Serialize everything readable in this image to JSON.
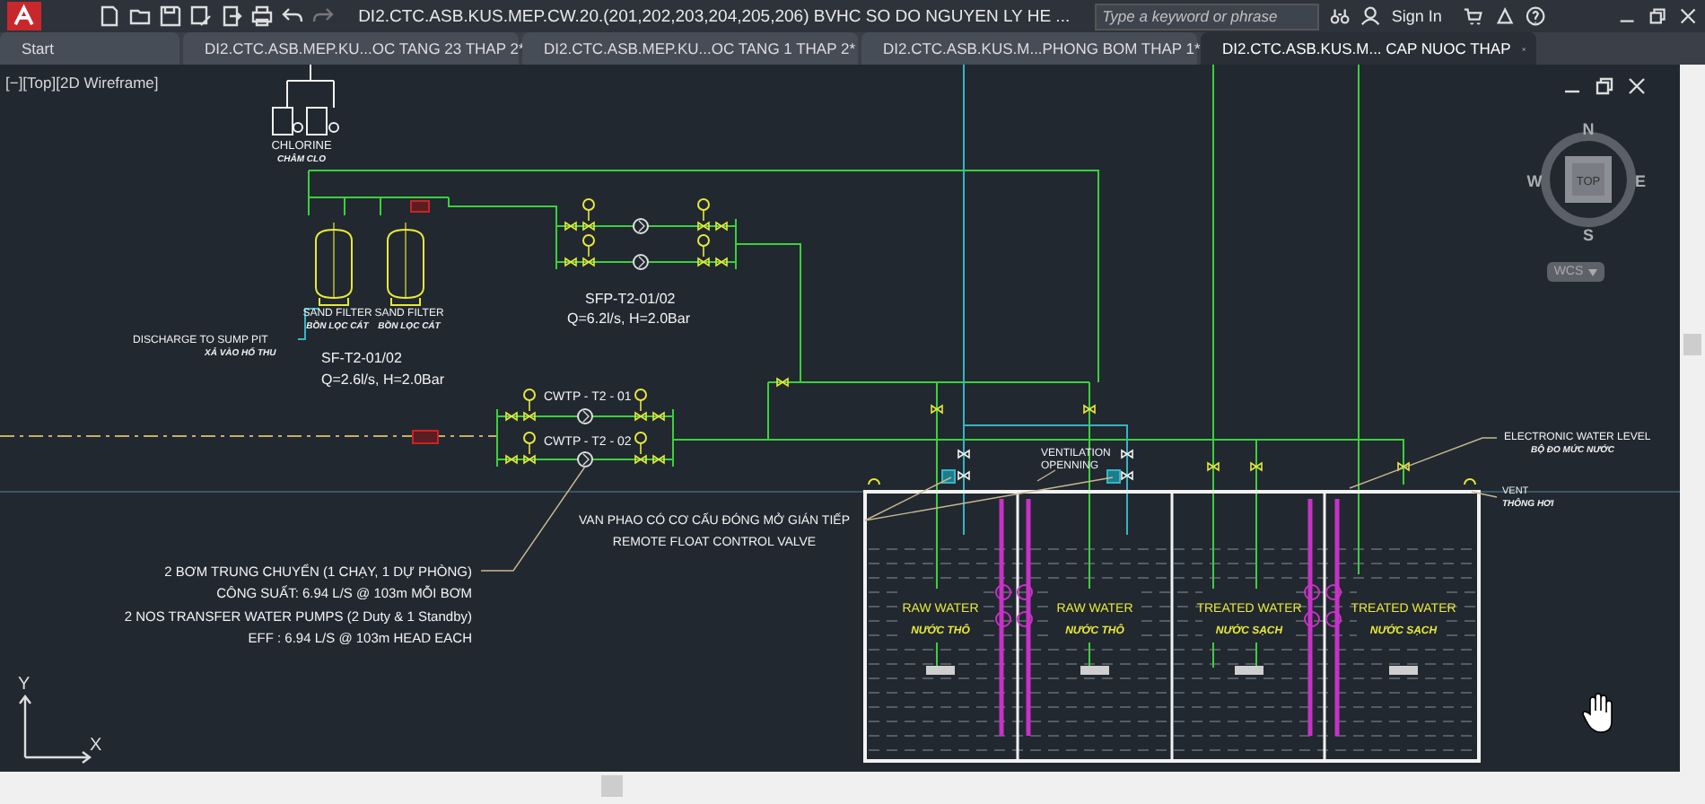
{
  "title_bar": {
    "title": "DI2.CTC.ASB.KUS.MEP.CW.20.(201,202,203,204,205,206) BVHC SO DO NGUYEN LY HE ...",
    "search": {
      "placeholder": "Type a keyword or phrase"
    },
    "sign_in": "Sign In"
  },
  "tabs": [
    {
      "label": "Start",
      "selected": false
    },
    {
      "label": "DI2.CTC.ASB.MEP.KU...OC TANG 23 THAP 2*",
      "selected": false
    },
    {
      "label": "DI2.CTC.ASB.MEP.KU...OC TANG 1 THAP 2*",
      "selected": false
    },
    {
      "label": "DI2.CTC.ASB.KUS.M...PHONG BOM THAP 1*",
      "selected": false
    },
    {
      "label": "DI2.CTC.ASB.KUS.M... CAP NUOC THAP",
      "selected": true
    }
  ],
  "viewport": {
    "label": "[−][Top][2D Wireframe]"
  },
  "view_cube": {
    "face": "TOP",
    "north": "N",
    "south": "S",
    "east": "E",
    "west": "W",
    "ucs": "WCS"
  },
  "ucs_icon": {
    "x_axis": "X",
    "y_axis": "Y"
  },
  "drawing": {
    "labels": [
      {
        "text": "CHLORINE",
        "kind": "plain"
      },
      {
        "text": "CHÂM CLO",
        "kind": "sub"
      },
      {
        "text": "SAND FILTER",
        "kind": "plain"
      },
      {
        "text": "BỒN LỌC CÁT",
        "kind": "sub"
      },
      {
        "text": "SAND FILTER",
        "kind": "plain"
      },
      {
        "text": "BỒN LỌC CÁT",
        "kind": "sub"
      },
      {
        "text": "DISCHARGE TO SUMP PIT",
        "kind": "plain"
      },
      {
        "text": "XẢ VÀO HỐ THU",
        "kind": "sub"
      },
      {
        "text": "SF-T2-01/02",
        "kind": "plain"
      },
      {
        "text": "Q=2.6l/s, H=2.0Bar",
        "kind": "plain"
      },
      {
        "text": "SFP-T2-01/02",
        "kind": "plain"
      },
      {
        "text": "Q=6.2l/s, H=2.0Bar",
        "kind": "plain"
      },
      {
        "text": "CWTP - T2 - 01",
        "kind": "plain"
      },
      {
        "text": "CWTP - T2 - 02",
        "kind": "plain"
      },
      {
        "text": "VENTILATION",
        "kind": "plain"
      },
      {
        "text": "OPENNING",
        "kind": "plain"
      },
      {
        "text": "ELECTRONIC WATER LEVEL",
        "kind": "plain"
      },
      {
        "text": "BỘ ĐO MỨC NƯỚC",
        "kind": "sub"
      },
      {
        "text": "VENT",
        "kind": "plain"
      },
      {
        "text": "THÔNG HƠI",
        "kind": "sub"
      },
      {
        "text": "VAN PHAO CÓ CƠ CẤU ĐÓNG MỞ GIÁN TIẾP",
        "kind": "plain"
      },
      {
        "text": "REMOTE FLOAT CONTROL VALVE",
        "kind": "plain"
      },
      {
        "text": "2 BƠM TRUNG CHUYỂN (1 CHẠY, 1 DỰ PHÒNG)",
        "kind": "plain"
      },
      {
        "text": "CÔNG SUẤT: 6.94 L/S @ 103m MỖI BƠM",
        "kind": "plain"
      },
      {
        "text": "2 NOS  TRANSFER  WATER  PUMPS (2 Duty & 1 Standby)",
        "kind": "plain"
      },
      {
        "text": "EFF : 6.94 L/S @ 103m HEAD EACH",
        "kind": "plain"
      }
    ],
    "tanks": [
      {
        "name": "RAW WATER",
        "sub": "NƯỚC THÔ"
      },
      {
        "name": "RAW WATER",
        "sub": "NƯỚC THÔ"
      },
      {
        "name": "TREATED WATER",
        "sub": "NƯỚC SẠCH"
      },
      {
        "name": "TREATED WATER",
        "sub": "NƯỚC SẠCH"
      }
    ]
  }
}
